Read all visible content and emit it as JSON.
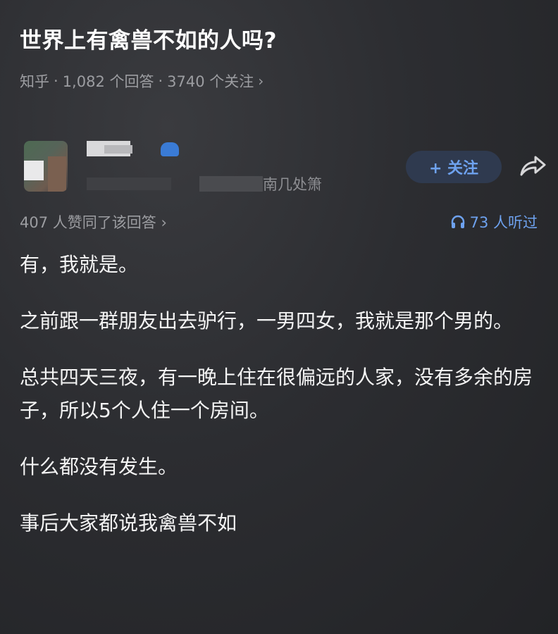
{
  "question": {
    "title": "世界上有禽兽不如的人吗?",
    "source": "知乎",
    "answer_count": "1,082 个回答",
    "follow_count": "3740 个关注",
    "separator": "·",
    "chevron": "›"
  },
  "author": {
    "bio_fragment": "南几处箫",
    "follow_label": "+ 关注"
  },
  "stats": {
    "agree_text": "407 人赞同了该回答",
    "agree_chevron": "›",
    "listen_text": "73 人听过"
  },
  "answer": {
    "paragraphs": [
      "有，我就是。",
      "之前跟一群朋友出去驴行，一男四女，我就是那个男的。",
      "总共四天三夜，有一晚上住在很偏远的人家，没有多余的房子，所以5个人住一个房间。",
      "什么都没有发生。",
      "事后大家都说我禽兽不如"
    ]
  },
  "colors": {
    "accent": "#6ea2ef",
    "muted": "#9c9da1",
    "background": "#2c2d31"
  }
}
